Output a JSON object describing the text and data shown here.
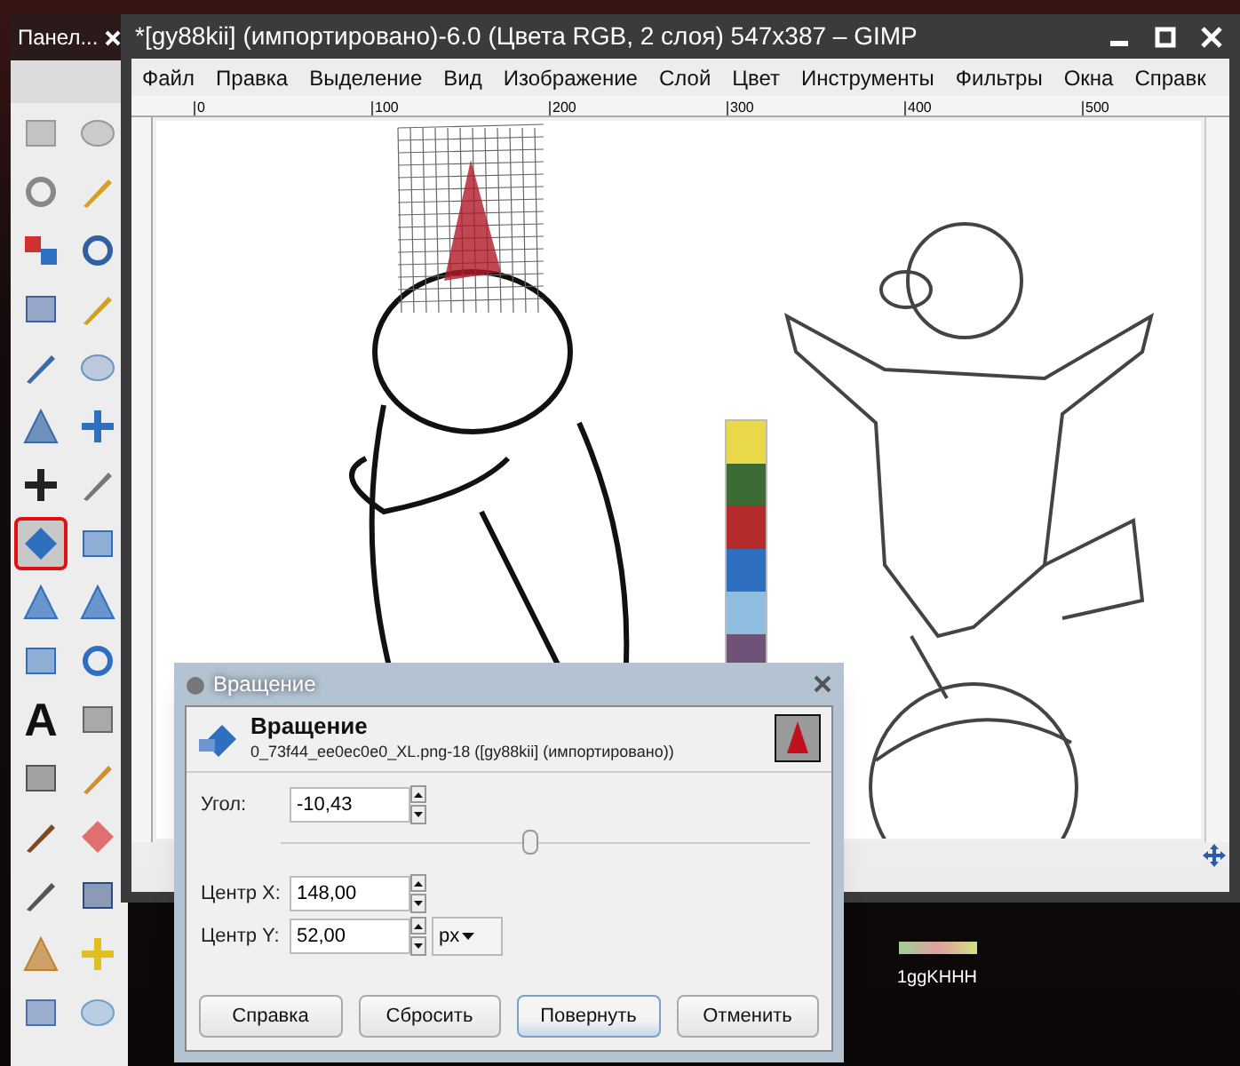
{
  "toolbox": {
    "title": "Панел...",
    "tools": [
      {
        "selected": false
      },
      {
        "selected": false
      },
      {
        "selected": false
      },
      {
        "selected": false
      },
      {
        "selected": false
      },
      {
        "selected": false
      },
      {
        "selected": false
      },
      {
        "selected": false
      },
      {
        "selected": false
      },
      {
        "selected": false
      },
      {
        "selected": false
      },
      {
        "selected": false
      },
      {
        "selected": false
      },
      {
        "selected": false
      },
      {
        "selected": true
      },
      {
        "selected": false
      },
      {
        "selected": false
      },
      {
        "selected": false
      },
      {
        "selected": false
      },
      {
        "selected": false
      },
      {
        "selected": false,
        "glyph": "A"
      },
      {
        "selected": false
      },
      {
        "selected": false
      },
      {
        "selected": false
      },
      {
        "selected": false
      },
      {
        "selected": false
      },
      {
        "selected": false
      },
      {
        "selected": false
      },
      {
        "selected": false
      },
      {
        "selected": false
      },
      {
        "selected": false
      },
      {
        "selected": false
      }
    ]
  },
  "window": {
    "title": "*[gy88kii] (импортировано)-6.0 (Цвета RGB, 2 слоя) 547x387 – GIMP"
  },
  "menu": [
    "Файл",
    "Правка",
    "Выделение",
    "Вид",
    "Изображение",
    "Слой",
    "Цвет",
    "Инструменты",
    "Фильтры",
    "Окна",
    "Справк"
  ],
  "ruler": {
    "marks": [
      "0",
      "100",
      "200",
      "300",
      "400",
      "500"
    ]
  },
  "swatches": [
    {
      "color": "#e8d84a"
    },
    {
      "color": "#3d6b35"
    },
    {
      "color": "#b52a2a"
    },
    {
      "color": "#2f6fc0"
    },
    {
      "color": "#8fbde0"
    },
    {
      "color": "#6e5278"
    }
  ],
  "dialog": {
    "title": "Вращение",
    "heading": "Вращение",
    "subtitle": "0_73f44_ee0ec0e0_XL.png-18 ([gy88kii] (импортировано))",
    "fields": [
      {
        "label": "Угол:",
        "value": "-10,43"
      },
      {
        "label": "Центр X:",
        "value": "148,00"
      },
      {
        "label": "Центр Y:",
        "value": "52,00"
      }
    ],
    "slider": {
      "level": 0.47
    },
    "unit": "px",
    "buttons": [
      {
        "label": "Справка",
        "default": false
      },
      {
        "label": "Сбросить",
        "default": false
      },
      {
        "label": "Повернуть",
        "default": true
      },
      {
        "label": "Отменить",
        "default": false
      }
    ]
  },
  "desktop_icon": {
    "label": "1ggKHHH"
  }
}
